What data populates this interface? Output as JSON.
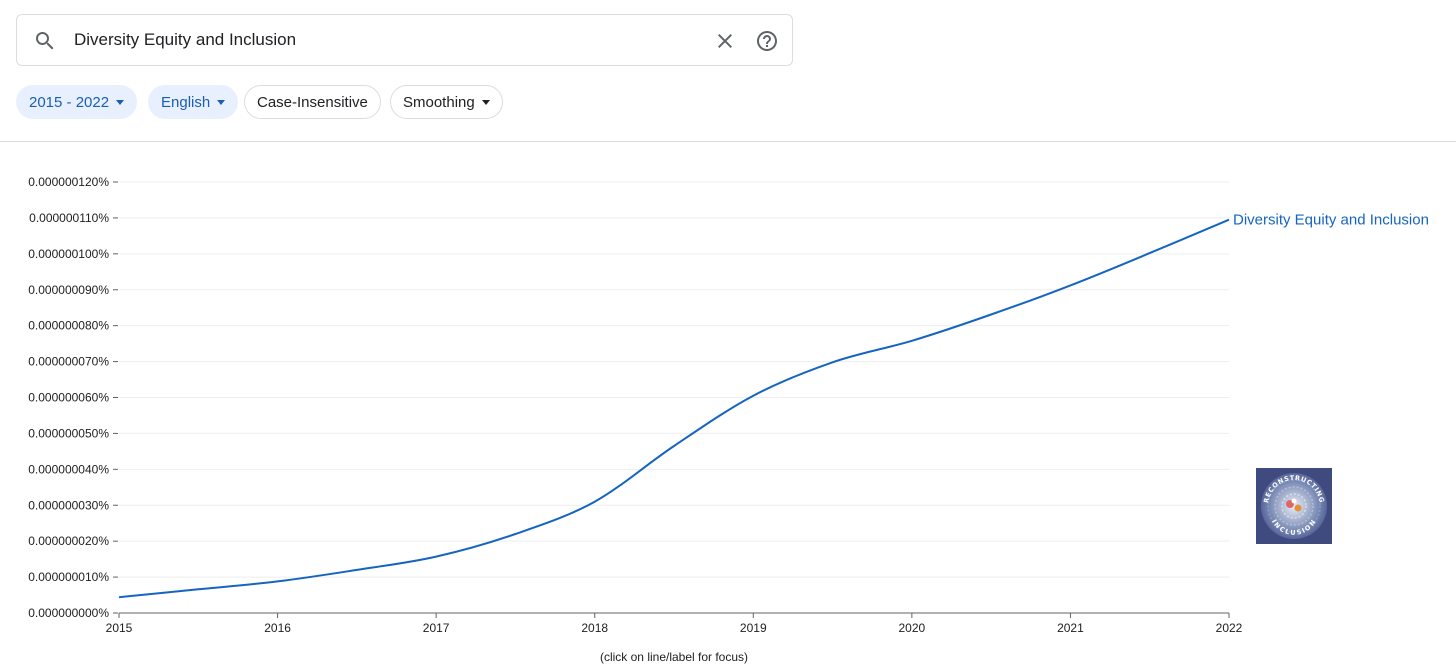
{
  "search": {
    "query": "Diversity Equity and Inclusion",
    "clear_icon": "close-icon",
    "help_icon": "help-circle-icon",
    "search_icon": "search-icon"
  },
  "filters": {
    "year_range": "2015 - 2022",
    "corpus": "English",
    "case": "Case-Insensitive",
    "smoothing": "Smoothing"
  },
  "colors": {
    "line": "#1565c0",
    "chip_active_bg": "#e8f0fe",
    "chip_active_text": "#1a5fb4"
  },
  "footer_hint": "(click on line/label for focus)",
  "logo": {
    "text_top": "RECONSTRUCTING",
    "text_bottom": "INCLUSION"
  },
  "chart_data": {
    "type": "line",
    "title": "",
    "xlabel": "",
    "ylabel": "",
    "x_ticks": [
      "2015",
      "2016",
      "2017",
      "2018",
      "2019",
      "2020",
      "2021",
      "2022"
    ],
    "y_ticks": [
      "0.000000000%",
      "0.000000010%",
      "0.000000020%",
      "0.000000030%",
      "0.000000040%",
      "0.000000050%",
      "0.000000060%",
      "0.000000070%",
      "0.000000080%",
      "0.000000090%",
      "0.000000100%",
      "0.000000110%",
      "0.000000120%"
    ],
    "xlim": [
      2015,
      2022
    ],
    "ylim": [
      0,
      1.2e-07
    ],
    "grid": true,
    "legend": "end-of-line label",
    "series": [
      {
        "name": "Diversity Equity and Inclusion",
        "x": [
          2015,
          2015.5,
          2016,
          2016.5,
          2017,
          2017.5,
          2018,
          2018.5,
          2019,
          2019.5,
          2020,
          2020.5,
          2021,
          2021.5,
          2022
        ],
        "values": [
          4.4e-09,
          6.6e-09,
          8.8e-09,
          1.2e-08,
          1.57e-08,
          2.2e-08,
          3.1e-08,
          4.65e-08,
          6.05e-08,
          6.98e-08,
          7.58e-08,
          8.31e-08,
          9.12e-08,
          1.002e-07,
          1.095e-07
        ]
      }
    ]
  }
}
